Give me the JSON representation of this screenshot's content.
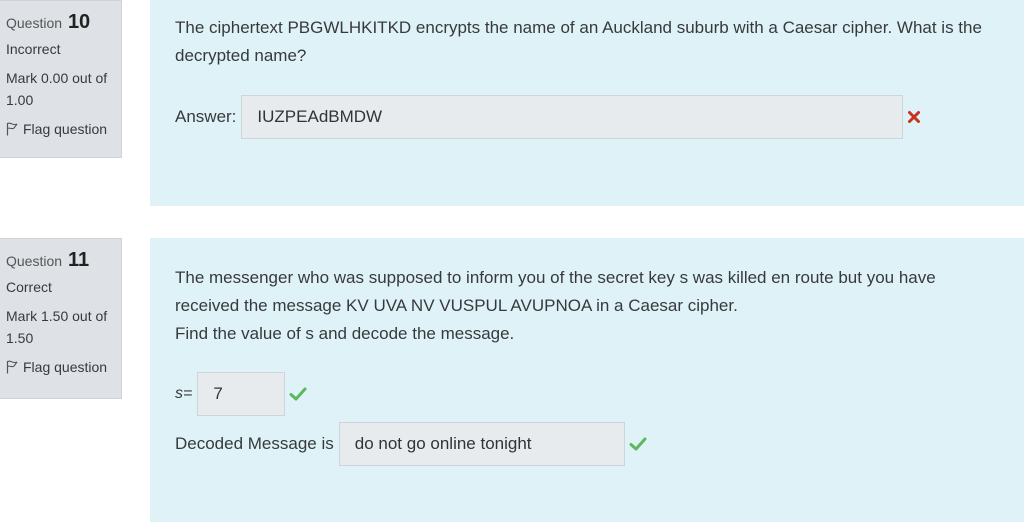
{
  "q10": {
    "label": "Question",
    "number": "10",
    "state": "Incorrect",
    "grade": "Mark 0.00 out of 1.00",
    "flag": "Flag question",
    "text": "The ciphertext PBGWLHKITKD encrypts the name of an Auckland suburb with a Caesar cipher. What is the decrypted name?",
    "answer_label": "Answer:",
    "answer_value": "IUZPEAdBMDW",
    "result_icon": "cross-icon",
    "colors": {
      "incorrect": "#ca3120"
    }
  },
  "q11": {
    "label": "Question",
    "number": "11",
    "state": "Correct",
    "grade": "Mark 1.50 out of 1.50",
    "flag": "Flag question",
    "text_line1": "The messenger who was supposed to inform you of the secret key s was killed en route but you have received the message KV UVA NV VUSPUL AVUPNOA in a Caesar cipher.",
    "text_line2": "Find the value of s and decode the message.",
    "s_label": "s=",
    "s_value": "7",
    "decoded_label": "Decoded Message is",
    "decoded_value": "do not go online tonight",
    "result_icon": "check-icon",
    "colors": {
      "correct": "#5cb85c"
    }
  }
}
